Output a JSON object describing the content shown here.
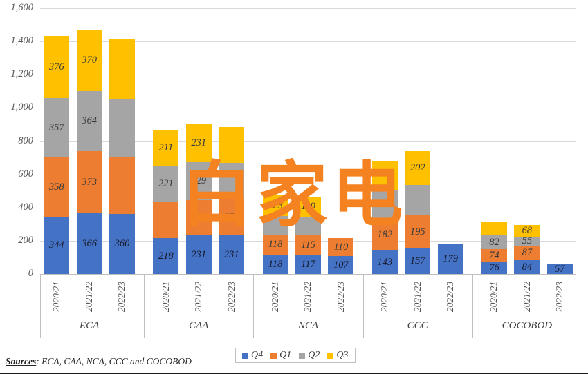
{
  "chart_data": {
    "type": "bar",
    "subtype": "stacked-grouped-column",
    "title": "",
    "xlabel": "",
    "ylabel": "",
    "ylim": [
      0,
      1600
    ],
    "ytick_step": 200,
    "ytick_labels": [
      "0",
      "200",
      "400",
      "600",
      "800",
      "1,000",
      "1,200",
      "1,400",
      "1,600"
    ],
    "grid": true,
    "legend_position": "bottom",
    "series": [
      {
        "name": "Q4",
        "color": "#4472c4",
        "values": [
          344,
          366,
          360,
          218,
          231,
          231,
          118,
          117,
          107,
          143,
          157,
          179,
          76,
          84,
          57
        ]
      },
      {
        "name": "Q1",
        "color": "#ed7d31",
        "values": [
          358,
          373,
          347,
          214,
          213,
          222,
          118,
          115,
          110,
          182,
          195,
          null,
          74,
          87,
          null
        ]
      },
      {
        "name": "Q2",
        "color": "#a5a5a5",
        "values": [
          357,
          364,
          350,
          221,
          229,
          218,
          114,
          113,
          null,
          179,
          185,
          null,
          82,
          55,
          null
        ]
      },
      {
        "name": "Q3",
        "color": "#ffc000",
        "values": [
          376,
          370,
          358,
          211,
          231,
          215,
          123,
          119,
          null,
          178,
          202,
          null,
          80,
          68,
          null
        ]
      }
    ],
    "groups": [
      {
        "label": "ECA",
        "categories": [
          "2020/21",
          "2021/22",
          "2022/23"
        ]
      },
      {
        "label": "CAA",
        "categories": [
          "2020/21",
          "2021/22",
          "2022/23"
        ]
      },
      {
        "label": "NCA",
        "categories": [
          "2020/21",
          "2021/22",
          "2022/23"
        ]
      },
      {
        "label": "CCC",
        "categories": [
          "2020/21",
          "2021/22",
          "2022/23"
        ]
      },
      {
        "label": "COCOBOD",
        "categories": [
          "2020/21",
          "2021/22",
          "2022/23"
        ]
      }
    ],
    "visible_data_labels": {
      "ECA": {
        "2020/21": {
          "Q4": "344",
          "Q1": "358",
          "Q2": "357",
          "Q3": "376"
        },
        "2021/22": {
          "Q4": "366",
          "Q1": "373",
          "Q2": "364",
          "Q3": "370"
        },
        "2022/23": {
          "Q4": "360",
          "Q1": "",
          "Q2": "",
          "Q3": ""
        }
      },
      "CAA": {
        "2020/21": {
          "Q4": "218",
          "Q1": "",
          "Q2": "221",
          "Q3": "211"
        },
        "2021/22": {
          "Q4": "231",
          "Q1": "213",
          "Q2": "229",
          "Q3": "231"
        },
        "2022/23": {
          "Q4": "231",
          "Q1": "222",
          "Q2": "",
          "Q3": ""
        }
      },
      "NCA": {
        "2020/21": {
          "Q4": "118",
          "Q1": "118",
          "Q2": "",
          "Q3": "123"
        },
        "2021/22": {
          "Q4": "117",
          "Q1": "115",
          "Q2": "",
          "Q3": "119"
        },
        "2022/23": {
          "Q4": "107",
          "Q1": "110",
          "Q2": "",
          "Q3": ""
        }
      },
      "CCC": {
        "2020/21": {
          "Q4": "143",
          "Q1": "182",
          "Q2": "",
          "Q3": ""
        },
        "2021/22": {
          "Q4": "157",
          "Q1": "195",
          "Q2": "",
          "Q3": "202"
        },
        "2022/23": {
          "Q4": "179",
          "Q1": "",
          "Q2": "",
          "Q3": ""
        }
      },
      "COCOBOD": {
        "2020/21": {
          "Q4": "76",
          "Q1": "74",
          "Q2": "82",
          "Q3": ""
        },
        "2021/22": {
          "Q4": "84",
          "Q1": "87",
          "Q2": "55",
          "Q3": "68"
        },
        "2022/23": {
          "Q4": "57",
          "Q1": "",
          "Q2": "",
          "Q3": ""
        }
      }
    }
  },
  "legend": {
    "items": [
      {
        "label": "Q4",
        "color": "#4472c4"
      },
      {
        "label": "Q1",
        "color": "#ed7d31"
      },
      {
        "label": "Q2",
        "color": "#a5a5a5"
      },
      {
        "label": "Q3",
        "color": "#ffc000"
      }
    ]
  },
  "footer": {
    "sources_key": "Sources",
    "sources_text": ": ECA, CAA, NCA, CCC and COCOBOD"
  },
  "watermark": {
    "text": "白家电"
  }
}
